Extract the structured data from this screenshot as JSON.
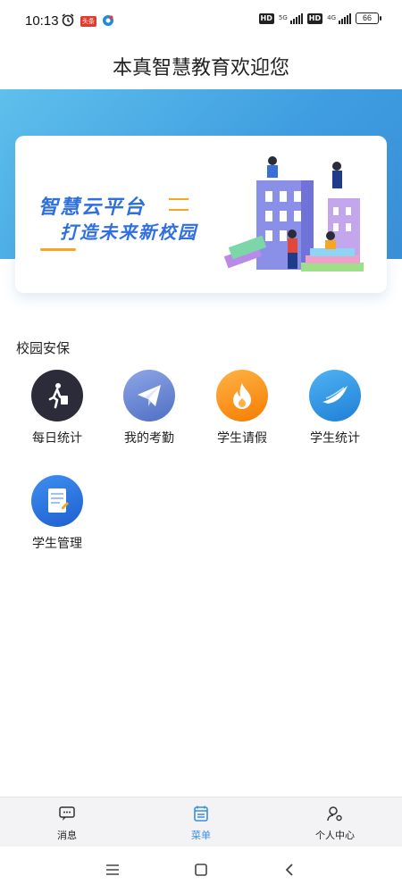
{
  "status_bar": {
    "time": "10:13",
    "badge_text": "头条",
    "net1": "5G",
    "net2": "4G",
    "battery": "66"
  },
  "header": {
    "title": "本真智慧教育欢迎您"
  },
  "banner": {
    "line1": "智慧云平台",
    "line2": "打造未来新校园"
  },
  "section": {
    "title": "校园安保",
    "items": [
      {
        "label": "每日统计",
        "icon": "walking-person-icon",
        "color": "#2b2b3a"
      },
      {
        "label": "我的考勤",
        "icon": "paper-plane-icon",
        "color": "#5b7fc8"
      },
      {
        "label": "学生请假",
        "icon": "flame-icon",
        "color": "#f7931e"
      },
      {
        "label": "学生统计",
        "icon": "wing-icon",
        "color": "#2a93e6"
      },
      {
        "label": "学生管理",
        "icon": "notebook-icon",
        "color": "#1f6fe0"
      }
    ]
  },
  "bottom_nav": {
    "items": [
      {
        "label": "消息",
        "icon": "message-icon"
      },
      {
        "label": "菜单",
        "icon": "calendar-menu-icon",
        "active": true
      },
      {
        "label": "个人中心",
        "icon": "user-settings-icon"
      }
    ],
    "active_color": "#3b8fe0"
  }
}
